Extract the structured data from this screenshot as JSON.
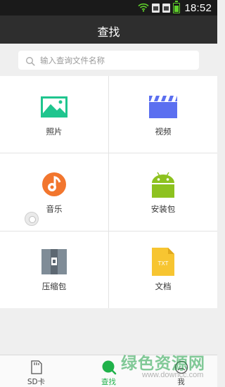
{
  "status_bar": {
    "time": "18:52"
  },
  "header": {
    "title": "查找"
  },
  "search": {
    "placeholder": "输入查询文件名称"
  },
  "categories": [
    {
      "label": "照片",
      "icon": "image-icon",
      "color": "#1fc58e"
    },
    {
      "label": "视频",
      "icon": "video-clapper-icon",
      "color": "#5b6ff0"
    },
    {
      "label": "音乐",
      "icon": "music-icon",
      "color": "#f2762e"
    },
    {
      "label": "安装包",
      "icon": "android-icon",
      "color": "#8dc21f"
    },
    {
      "label": "压缩包",
      "icon": "zip-archive-icon",
      "color": "#7f8c97"
    },
    {
      "label": "文档",
      "icon": "txt-document-icon",
      "color": "#f7c531",
      "icon_text": "TXT"
    }
  ],
  "bottom_nav": [
    {
      "label": "SD卡",
      "icon": "sd-card-icon",
      "active": false
    },
    {
      "label": "查找",
      "icon": "search-icon",
      "active": true
    },
    {
      "label": "我",
      "icon": "profile-icon",
      "active": false
    }
  ],
  "watermark": {
    "main": "绿色资源网",
    "sub": "www.downcc.com"
  },
  "colors": {
    "accent": "#20b24a",
    "title_bar": "#2e2e2e",
    "status_bar": "#1a1a1a"
  }
}
